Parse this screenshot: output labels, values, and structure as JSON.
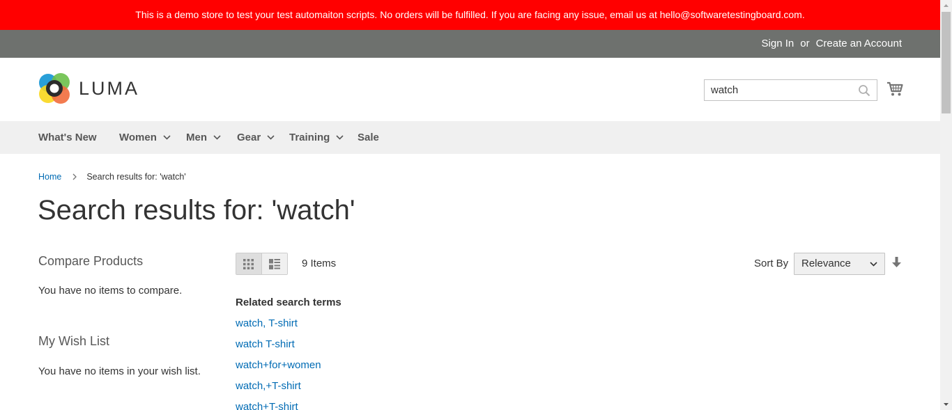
{
  "banner": {
    "text": "This is a demo store to test your test automaiton scripts. No orders will be fulfilled. If you are facing any issue, email us at hello@softwaretestingboard.com."
  },
  "top_links": {
    "sign_in": "Sign In",
    "or": "or",
    "create_account": "Create an Account"
  },
  "header": {
    "logo_text": "LUMA",
    "search_value": "watch"
  },
  "nav": {
    "items": [
      {
        "label": "What's New",
        "has_dropdown": false
      },
      {
        "label": "Women",
        "has_dropdown": true
      },
      {
        "label": "Men",
        "has_dropdown": true
      },
      {
        "label": "Gear",
        "has_dropdown": true
      },
      {
        "label": "Training",
        "has_dropdown": true
      },
      {
        "label": "Sale",
        "has_dropdown": false
      }
    ]
  },
  "breadcrumb": {
    "home": "Home",
    "current": "Search results for: 'watch'"
  },
  "page_title": "Search results for: 'watch'",
  "sidebar": {
    "compare_title": "Compare Products",
    "compare_empty": "You have no items to compare.",
    "wishlist_title": "My Wish List",
    "wishlist_empty": "You have no items in your wish list."
  },
  "toolbar": {
    "active_mode": "grid",
    "items_count": "9 Items",
    "sort_label": "Sort By",
    "sort_value": "Relevance"
  },
  "related": {
    "title": "Related search terms",
    "terms": [
      "watch, T-shirt",
      "watch T-shirt",
      "watch+for+women",
      "watch,+T-shirt",
      "watch+T-shirt"
    ]
  },
  "colors": {
    "banner_bg": "#ff0000",
    "top_bar_bg": "#6e716e",
    "nav_bg": "#f0f0f0",
    "link": "#006bb4"
  }
}
